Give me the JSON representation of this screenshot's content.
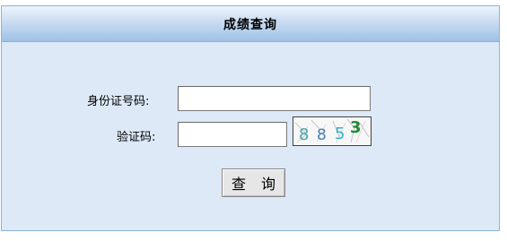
{
  "panel": {
    "title": "成绩查询"
  },
  "form": {
    "id_label": "身份证号码:",
    "id_value": "",
    "code_label": "验证码:",
    "code_value": "",
    "captcha_digits": [
      {
        "char": "8",
        "color": "#4aa3a8"
      },
      {
        "char": "8",
        "color": "#4a7fb8"
      },
      {
        "char": "5",
        "color": "#3bb0c8"
      },
      {
        "char": "3",
        "color": "#1f8a3a"
      }
    ],
    "submit_label": "查 询"
  }
}
